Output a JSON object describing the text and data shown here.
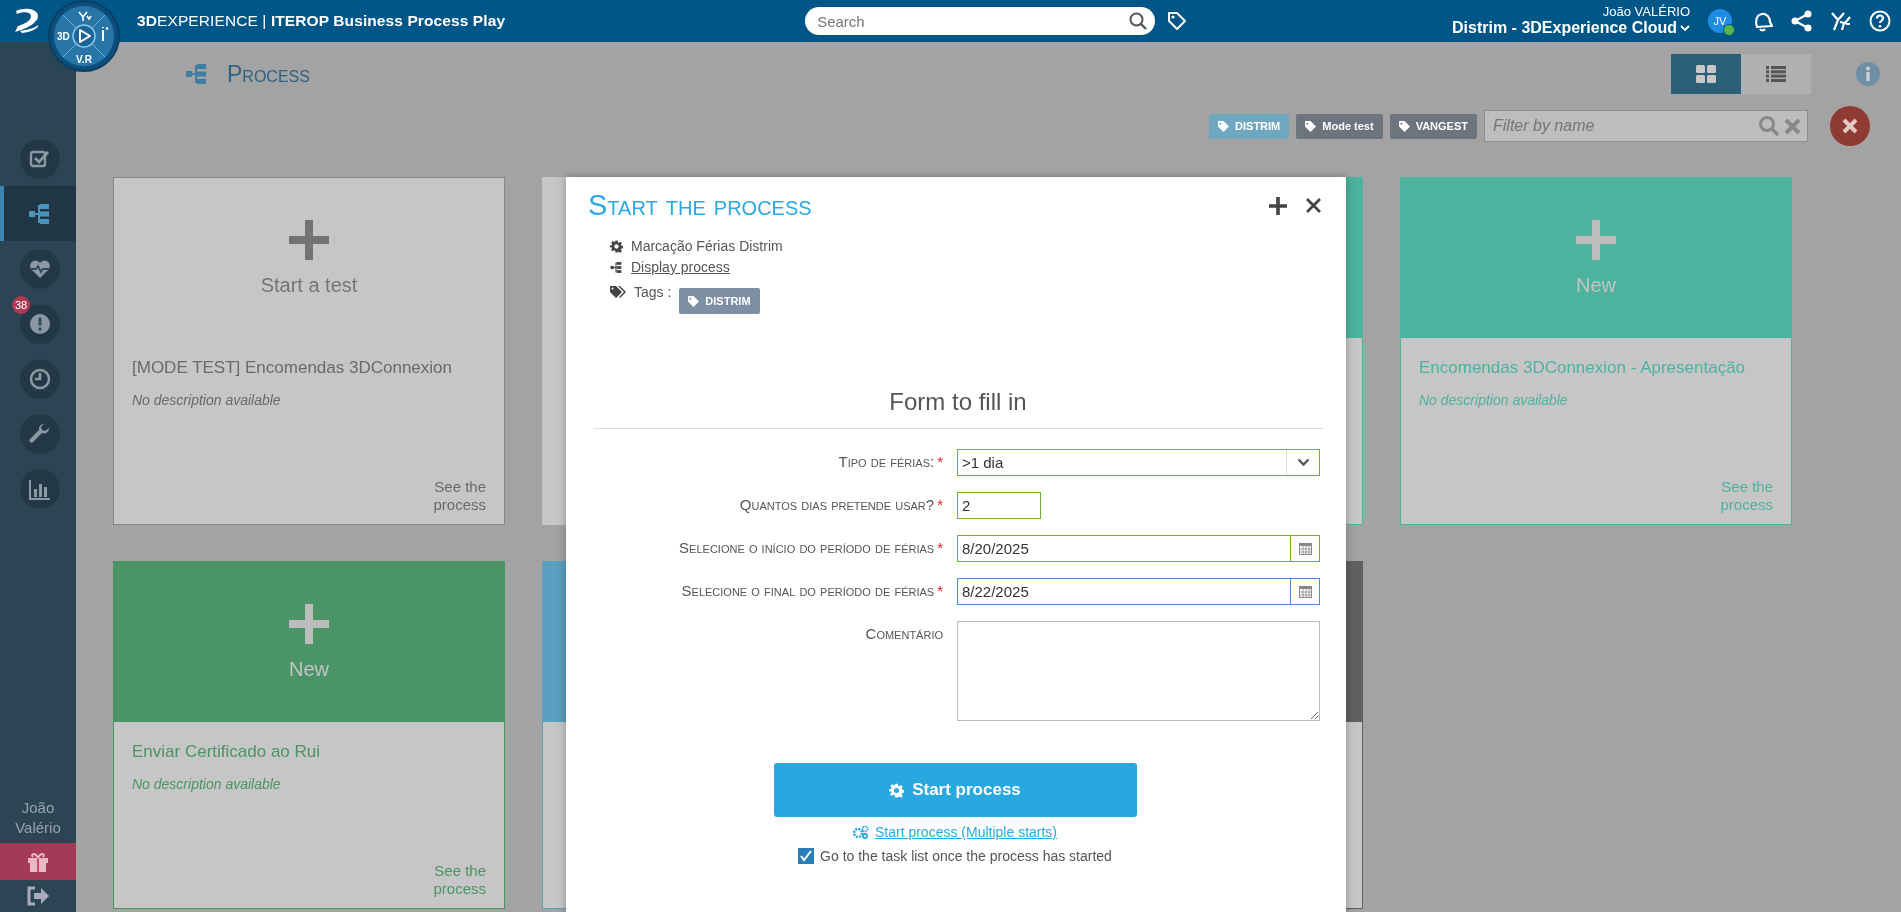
{
  "top_bar": {
    "compass_labels": [
      "3D",
      "V.R"
    ],
    "brand": "**3D**EXPERIENCE | **ITEROP Business Process Play**",
    "search": {
      "placeholder": "Search"
    },
    "user": {
      "name": "João VALÉRIO",
      "tenant": "Distrim - 3DExperience Cloud",
      "initials": "JV",
      "online": true
    }
  },
  "sidebar": {
    "items": [
      {
        "kind": "tasks",
        "selected": false
      },
      {
        "kind": "process",
        "selected": true
      },
      {
        "kind": "health",
        "selected": false
      },
      {
        "kind": "alerts",
        "selected": false,
        "badge": "38"
      },
      {
        "kind": "history",
        "selected": false
      },
      {
        "kind": "settings",
        "selected": false
      },
      {
        "kind": "reports",
        "selected": false
      }
    ],
    "user_name": "João Valério"
  },
  "page": {
    "title": "Process",
    "views": [
      {
        "kind": "grid",
        "selected": true
      },
      {
        "kind": "list",
        "selected": false
      }
    ],
    "tags": [
      {
        "label": "DISTRIM",
        "selected": true
      },
      {
        "label": "Mode test",
        "selected": false
      },
      {
        "label": "VANGEST",
        "selected": false
      }
    ],
    "filter": {
      "placeholder": "Filter by name"
    }
  },
  "cards": [
    {
      "kind": "test",
      "action": "Start a test",
      "title": "[MODE TEST] Encomendas 3DConnexion",
      "description": "No description available",
      "link": "See the process"
    },
    {
      "kind": "covered",
      "color": "#c6c6c6"
    },
    {
      "kind": "covered",
      "color": "#4db39e"
    },
    {
      "kind": "new",
      "color": "#4db39e",
      "action": "New",
      "title": "Encomendas 3DConnexion - Apresentação",
      "description": "No description available",
      "link": "See the process"
    },
    {
      "kind": "new",
      "color": "#4a9465",
      "action": "New",
      "title": "Enviar Certificado ao Rui",
      "description": "No description available",
      "link": "See the process"
    },
    {
      "kind": "covered",
      "color": "#5aa0c0"
    },
    {
      "kind": "covered",
      "color": "#606060"
    }
  ],
  "dialog": {
    "title": "Start the process",
    "process_name": "Marcação Férias Distrim",
    "display_link": "Display process",
    "tags_label": "Tags :",
    "tags": [
      "DISTRIM"
    ],
    "form_title": "Form to fill in",
    "fields": [
      {
        "kind": "select",
        "label": "Tipo de férias:",
        "required_mark": "*",
        "value": ">1 dia",
        "valid": true,
        "focused": false
      },
      {
        "kind": "number",
        "label": "Quantos dias pretende usar?",
        "required_mark": "*",
        "value": "2",
        "valid": true,
        "focused": false
      },
      {
        "kind": "date",
        "label": "Selecione o início do período de férias",
        "required_mark": "*",
        "value": "8/20/2025",
        "valid": true,
        "focused": false
      },
      {
        "kind": "date",
        "label": "Selecione o final do período de férias",
        "required_mark": "*",
        "value": "8/22/2025",
        "valid": false,
        "focused": true
      },
      {
        "kind": "textarea",
        "label": "Comentário",
        "valid": false,
        "focused": false
      }
    ],
    "start_button": "Start process",
    "multi_start_link": "Start process (Multiple starts)",
    "go_to_tasks": {
      "label": "Go to the task list once the process has started",
      "checked": true
    }
  }
}
